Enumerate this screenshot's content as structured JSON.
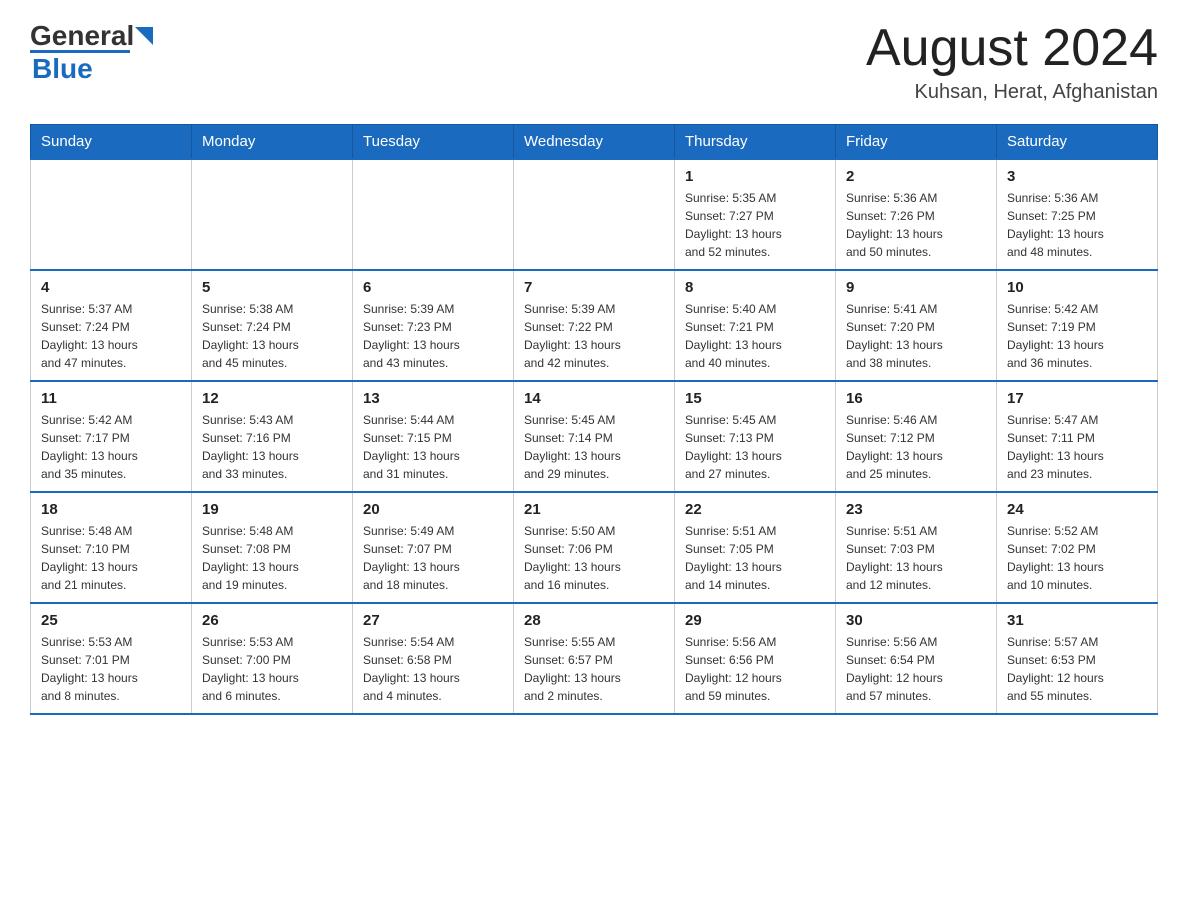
{
  "header": {
    "logo_general": "General",
    "logo_blue": "Blue",
    "month_title": "August 2024",
    "location": "Kuhsan, Herat, Afghanistan"
  },
  "weekdays": [
    "Sunday",
    "Monday",
    "Tuesday",
    "Wednesday",
    "Thursday",
    "Friday",
    "Saturday"
  ],
  "weeks": [
    [
      {
        "day": "",
        "info": ""
      },
      {
        "day": "",
        "info": ""
      },
      {
        "day": "",
        "info": ""
      },
      {
        "day": "",
        "info": ""
      },
      {
        "day": "1",
        "info": "Sunrise: 5:35 AM\nSunset: 7:27 PM\nDaylight: 13 hours\nand 52 minutes."
      },
      {
        "day": "2",
        "info": "Sunrise: 5:36 AM\nSunset: 7:26 PM\nDaylight: 13 hours\nand 50 minutes."
      },
      {
        "day": "3",
        "info": "Sunrise: 5:36 AM\nSunset: 7:25 PM\nDaylight: 13 hours\nand 48 minutes."
      }
    ],
    [
      {
        "day": "4",
        "info": "Sunrise: 5:37 AM\nSunset: 7:24 PM\nDaylight: 13 hours\nand 47 minutes."
      },
      {
        "day": "5",
        "info": "Sunrise: 5:38 AM\nSunset: 7:24 PM\nDaylight: 13 hours\nand 45 minutes."
      },
      {
        "day": "6",
        "info": "Sunrise: 5:39 AM\nSunset: 7:23 PM\nDaylight: 13 hours\nand 43 minutes."
      },
      {
        "day": "7",
        "info": "Sunrise: 5:39 AM\nSunset: 7:22 PM\nDaylight: 13 hours\nand 42 minutes."
      },
      {
        "day": "8",
        "info": "Sunrise: 5:40 AM\nSunset: 7:21 PM\nDaylight: 13 hours\nand 40 minutes."
      },
      {
        "day": "9",
        "info": "Sunrise: 5:41 AM\nSunset: 7:20 PM\nDaylight: 13 hours\nand 38 minutes."
      },
      {
        "day": "10",
        "info": "Sunrise: 5:42 AM\nSunset: 7:19 PM\nDaylight: 13 hours\nand 36 minutes."
      }
    ],
    [
      {
        "day": "11",
        "info": "Sunrise: 5:42 AM\nSunset: 7:17 PM\nDaylight: 13 hours\nand 35 minutes."
      },
      {
        "day": "12",
        "info": "Sunrise: 5:43 AM\nSunset: 7:16 PM\nDaylight: 13 hours\nand 33 minutes."
      },
      {
        "day": "13",
        "info": "Sunrise: 5:44 AM\nSunset: 7:15 PM\nDaylight: 13 hours\nand 31 minutes."
      },
      {
        "day": "14",
        "info": "Sunrise: 5:45 AM\nSunset: 7:14 PM\nDaylight: 13 hours\nand 29 minutes."
      },
      {
        "day": "15",
        "info": "Sunrise: 5:45 AM\nSunset: 7:13 PM\nDaylight: 13 hours\nand 27 minutes."
      },
      {
        "day": "16",
        "info": "Sunrise: 5:46 AM\nSunset: 7:12 PM\nDaylight: 13 hours\nand 25 minutes."
      },
      {
        "day": "17",
        "info": "Sunrise: 5:47 AM\nSunset: 7:11 PM\nDaylight: 13 hours\nand 23 minutes."
      }
    ],
    [
      {
        "day": "18",
        "info": "Sunrise: 5:48 AM\nSunset: 7:10 PM\nDaylight: 13 hours\nand 21 minutes."
      },
      {
        "day": "19",
        "info": "Sunrise: 5:48 AM\nSunset: 7:08 PM\nDaylight: 13 hours\nand 19 minutes."
      },
      {
        "day": "20",
        "info": "Sunrise: 5:49 AM\nSunset: 7:07 PM\nDaylight: 13 hours\nand 18 minutes."
      },
      {
        "day": "21",
        "info": "Sunrise: 5:50 AM\nSunset: 7:06 PM\nDaylight: 13 hours\nand 16 minutes."
      },
      {
        "day": "22",
        "info": "Sunrise: 5:51 AM\nSunset: 7:05 PM\nDaylight: 13 hours\nand 14 minutes."
      },
      {
        "day": "23",
        "info": "Sunrise: 5:51 AM\nSunset: 7:03 PM\nDaylight: 13 hours\nand 12 minutes."
      },
      {
        "day": "24",
        "info": "Sunrise: 5:52 AM\nSunset: 7:02 PM\nDaylight: 13 hours\nand 10 minutes."
      }
    ],
    [
      {
        "day": "25",
        "info": "Sunrise: 5:53 AM\nSunset: 7:01 PM\nDaylight: 13 hours\nand 8 minutes."
      },
      {
        "day": "26",
        "info": "Sunrise: 5:53 AM\nSunset: 7:00 PM\nDaylight: 13 hours\nand 6 minutes."
      },
      {
        "day": "27",
        "info": "Sunrise: 5:54 AM\nSunset: 6:58 PM\nDaylight: 13 hours\nand 4 minutes."
      },
      {
        "day": "28",
        "info": "Sunrise: 5:55 AM\nSunset: 6:57 PM\nDaylight: 13 hours\nand 2 minutes."
      },
      {
        "day": "29",
        "info": "Sunrise: 5:56 AM\nSunset: 6:56 PM\nDaylight: 12 hours\nand 59 minutes."
      },
      {
        "day": "30",
        "info": "Sunrise: 5:56 AM\nSunset: 6:54 PM\nDaylight: 12 hours\nand 57 minutes."
      },
      {
        "day": "31",
        "info": "Sunrise: 5:57 AM\nSunset: 6:53 PM\nDaylight: 12 hours\nand 55 minutes."
      }
    ]
  ]
}
